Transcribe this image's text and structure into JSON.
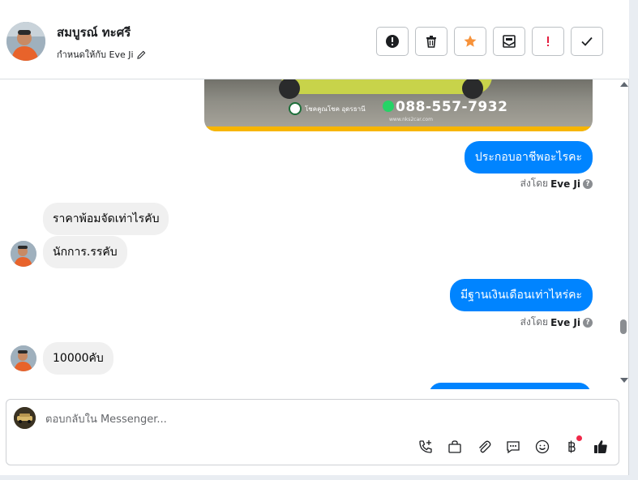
{
  "header": {
    "contact_name": "สมบูรณ์ ทะศรี",
    "assigned_label": "กำหนดให้กับ Eve Ji",
    "actions": [
      {
        "icon": "alert-circle-icon",
        "label": "report"
      },
      {
        "icon": "trash-icon",
        "label": "delete"
      },
      {
        "icon": "star-icon",
        "label": "star"
      },
      {
        "icon": "mark-unread-icon",
        "label": "mark-unread"
      },
      {
        "icon": "exclamation-icon",
        "label": "important"
      },
      {
        "icon": "check-icon",
        "label": "done"
      }
    ]
  },
  "colors": {
    "accent": "#0084ff",
    "star": "#f7923a",
    "important": "#e41e3f"
  },
  "thread": {
    "image_card": {
      "phone": "088-557-7932",
      "brand": "โชคคูณโชค อุดรธานี",
      "url": "www.nks2car.com"
    },
    "messages": [
      {
        "dir": "out",
        "text": "ประกอบอาชีพอะไรคะ",
        "sent_by_prefix": "ส่งโดย",
        "sent_by": "Eve Ji"
      },
      {
        "dir": "in",
        "text": "ราคาพ้อมจัดเท่าไรคับ"
      },
      {
        "dir": "in",
        "text": "นักการ.รรคับ"
      },
      {
        "dir": "out",
        "text": "มีฐานเงินเดือนเท่าไหร่คะ",
        "sent_by_prefix": "ส่งโดย",
        "sent_by": "Eve Ji"
      },
      {
        "dir": "in",
        "text": "10000คับ"
      }
    ]
  },
  "composer": {
    "placeholder": "ตอบกลับใน Messenger...",
    "tools": [
      "add-call-icon",
      "shopping-bag-icon",
      "paperclip-icon",
      "saved-reply-icon",
      "emoji-icon",
      "baht-payment-icon",
      "thumbs-up-icon"
    ]
  }
}
